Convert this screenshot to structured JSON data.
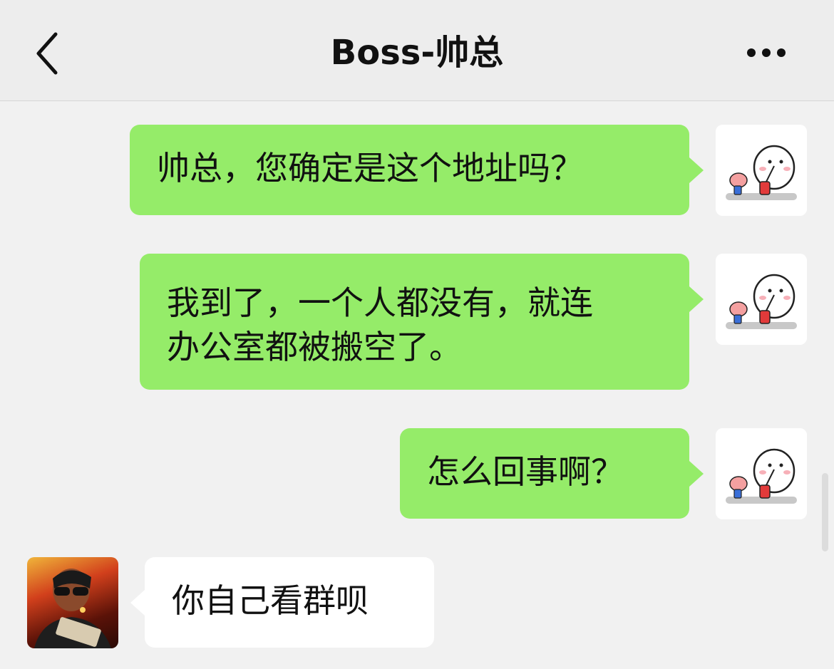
{
  "header": {
    "title": "Boss-帅总",
    "back_icon": "chevron-left-icon",
    "more_icon": "more-dots-icon"
  },
  "messages": [
    {
      "direction": "out",
      "text": "帅总，您确定是这个地址吗？"
    },
    {
      "direction": "out",
      "lines": [
        "我到了，一个人都没有，就连",
        "办公室都被搬空了。"
      ]
    },
    {
      "direction": "out",
      "text": "怎么回事啊？"
    },
    {
      "direction": "in",
      "text": "你自己看群呗"
    }
  ],
  "colors": {
    "outgoing_bubble": "#95ec69",
    "incoming_bubble": "#ffffff",
    "background": "#f1f1f1",
    "header": "#ededed"
  }
}
